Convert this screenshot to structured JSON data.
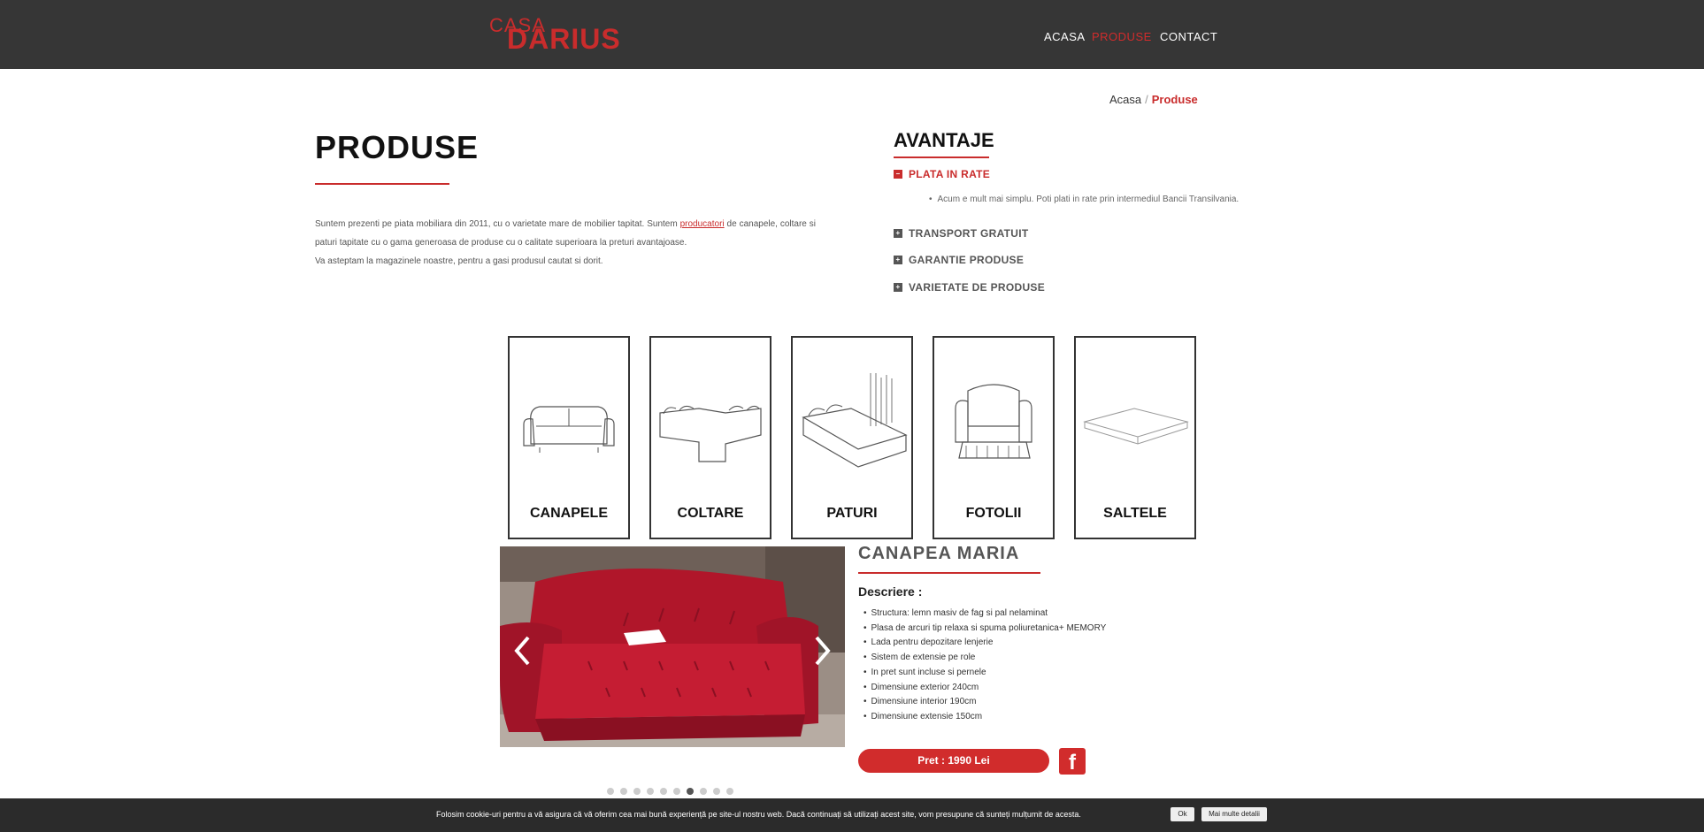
{
  "header": {
    "logo_top": "CASA",
    "logo_main": "DARIUS",
    "nav": [
      "ACASA",
      "PRODUSE",
      "CONTACT"
    ],
    "active_nav": "PRODUSE"
  },
  "breadcrumb": {
    "home": "Acasa",
    "separator": "/",
    "current": "Produse"
  },
  "intro": {
    "title": "PRODUSE",
    "text_before_link": "Suntem prezenti pe piata mobiliara din 2011, cu o varietate mare de mobilier tapitat. Suntem ",
    "link": "producatori",
    "text_after_link": " de canapele, coltare si paturi tapitate cu o gama generoasa de produse cu o calitate superioara la preturi avantajoase.",
    "text_line2": "Va asteptam la magazinele noastre, pentru a gasi produsul cautat si dorit."
  },
  "advantages": {
    "title": "AVANTAJE",
    "items": [
      "PLATA IN RATE",
      "TRANSPORT GRATUIT",
      "GARANTIE PRODUSE",
      "VARIETATE DE PRODUSE"
    ],
    "open_content": "Acum e mult mai simplu. Poti plati in rate prin intermediul Bancii Transilvania."
  },
  "categories": [
    "CANAPELE",
    "COLTARE",
    "PATURI",
    "FOTOLII",
    "SALTELE"
  ],
  "product": {
    "title": "CANAPEA MARIA",
    "desc_label": "Descriere :",
    "features": [
      "Structura: lemn masiv de fag si pal nelaminat",
      "Plasa de arcuri tip relaxa si spuma poliuretanica+ MEMORY",
      "Lada pentru depozitare lenjerie",
      "Sistem de extensie pe role",
      "In pret sunt incluse si pernele",
      "Dimensiune exterior 240cm",
      "Dimensiune interior 190cm",
      "Dimensiune extensie 150cm"
    ],
    "price_label": "Pret : ",
    "price_value": "1990 Lei",
    "facebook_glyph": "f",
    "slide_dots": 10,
    "active_dot": 7
  },
  "cookie": {
    "text": "Folosim cookie-uri pentru a vă asigura că vă oferim cea mai bună experiență pe site-ul nostru web. Dacă continuați să utilizați acest site, vom presupune că sunteți mulțumit de acesta.",
    "ok": "Ok",
    "more": "Mai multe detalii"
  },
  "colors": {
    "accent": "#d12c2c",
    "header_bg": "#363636",
    "cookie_bg": "#2b2b2b"
  },
  "icons": {
    "prev": "chevron-left-icon",
    "next": "chevron-right-icon",
    "facebook": "facebook-icon"
  }
}
